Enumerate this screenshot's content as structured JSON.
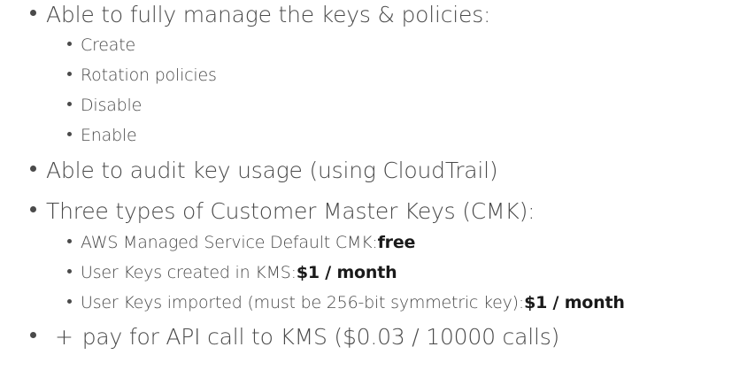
{
  "items": [
    {
      "text": "Able to fully manage the keys & policies:"
    },
    {
      "text": "Create"
    },
    {
      "text": "Rotation policies"
    },
    {
      "text": "Disable"
    },
    {
      "text": "Enable"
    },
    {
      "text": "Able to audit key usage (using CloudTrail)"
    },
    {
      "text": "Three types of Customer Master Keys (CMK):"
    },
    {
      "text": "AWS Managed Service Default CMK: ",
      "strong": "free"
    },
    {
      "text": "User Keys created in KMS: ",
      "strong": "$1 / month"
    },
    {
      "text": "User Keys imported (must be 256-bit symmetric key): ",
      "strong": "$1 / month"
    },
    {
      "plus": "+",
      "text": "pay for API call to KMS ($0.03 / 10000 calls)"
    }
  ]
}
